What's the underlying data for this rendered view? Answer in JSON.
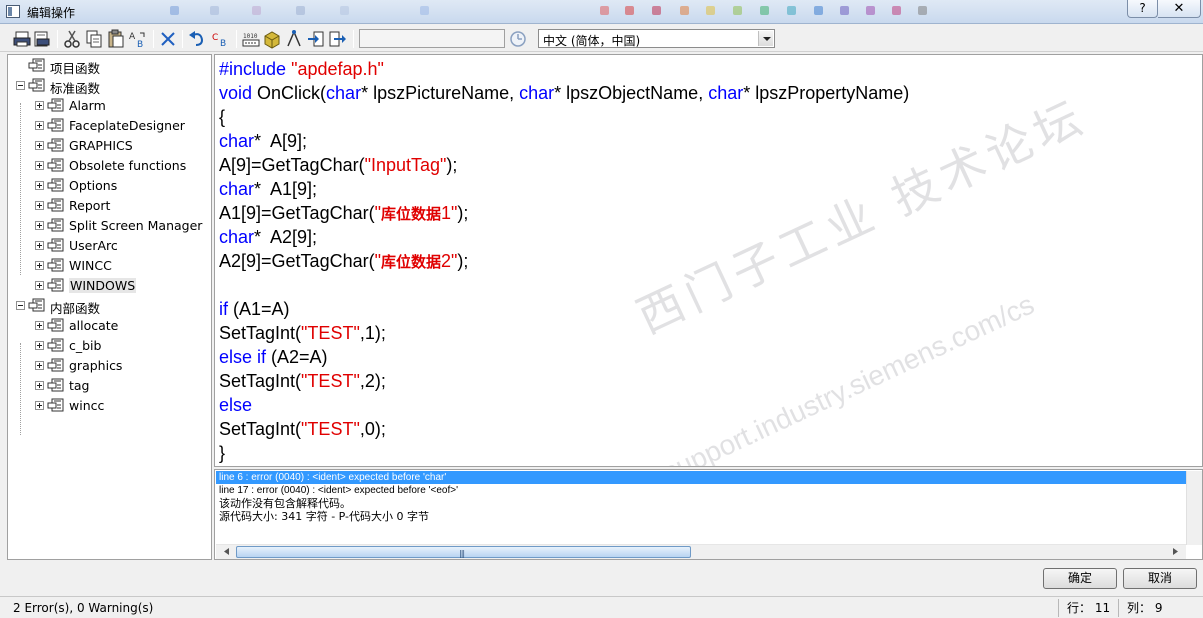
{
  "window": {
    "title": "编辑操作",
    "help_label": "?",
    "close_label": "✕"
  },
  "toolbar": {
    "icons": [
      "print-icon",
      "print-preview-icon",
      "cut-icon",
      "copy-icon",
      "paste-icon",
      "find-replace-icon",
      "delete-icon",
      "undo-icon",
      "spell-check-icon",
      "compile-icon",
      "box-icon",
      "tag-icon",
      "import-icon",
      "export-icon",
      "clock-icon"
    ],
    "blank_input_value": "",
    "language_select": "中文 (简体，中国)"
  },
  "tree": {
    "items": [
      {
        "label": "项目函数",
        "level": 0,
        "toggle": "none"
      },
      {
        "label": "标准函数",
        "level": 0,
        "toggle": "minus"
      },
      {
        "label": "Alarm",
        "level": 1,
        "toggle": "plus"
      },
      {
        "label": "FaceplateDesigner",
        "level": 1,
        "toggle": "plus"
      },
      {
        "label": "GRAPHICS",
        "level": 1,
        "toggle": "plus"
      },
      {
        "label": "Obsolete functions",
        "level": 1,
        "toggle": "plus"
      },
      {
        "label": "Options",
        "level": 1,
        "toggle": "plus"
      },
      {
        "label": "Report",
        "level": 1,
        "toggle": "plus"
      },
      {
        "label": "Split Screen Manager",
        "level": 1,
        "toggle": "plus"
      },
      {
        "label": "UserArc",
        "level": 1,
        "toggle": "plus"
      },
      {
        "label": "WINCC",
        "level": 1,
        "toggle": "plus"
      },
      {
        "label": "WINDOWS",
        "level": 1,
        "toggle": "plus",
        "selected": true
      },
      {
        "label": "内部函数",
        "level": 0,
        "toggle": "minus"
      },
      {
        "label": "allocate",
        "level": 1,
        "toggle": "plus"
      },
      {
        "label": "c_bib",
        "level": 1,
        "toggle": "plus"
      },
      {
        "label": "graphics",
        "level": 1,
        "toggle": "plus"
      },
      {
        "label": "tag",
        "level": 1,
        "toggle": "plus"
      },
      {
        "label": "wincc",
        "level": 1,
        "toggle": "plus"
      }
    ]
  },
  "code": {
    "lines": [
      [
        {
          "t": "#include ",
          "c": "kw"
        },
        {
          "t": "\"apdefap.h\"",
          "c": "str"
        }
      ],
      [
        {
          "t": "void",
          "c": "kw"
        },
        {
          "t": " OnClick("
        },
        {
          "t": "char",
          "c": "kw"
        },
        {
          "t": "* lpszPictureName, "
        },
        {
          "t": "char",
          "c": "kw"
        },
        {
          "t": "* lpszObjectName, "
        },
        {
          "t": "char",
          "c": "kw"
        },
        {
          "t": "* lpszPropertyName)"
        }
      ],
      [
        {
          "t": "{"
        }
      ],
      [
        {
          "t": "char",
          "c": "kw"
        },
        {
          "t": "*  A[9];"
        }
      ],
      [
        {
          "t": "A[9]=GetTagChar("
        },
        {
          "t": "\"InputTag\"",
          "c": "str"
        },
        {
          "t": ");"
        }
      ],
      [
        {
          "t": "char",
          "c": "kw"
        },
        {
          "t": "*  A1[9];"
        }
      ],
      [
        {
          "t": "A1[9]=GetTagChar("
        },
        {
          "t": "\"",
          "c": "str"
        },
        {
          "t": "库位数据",
          "c": "str-cn"
        },
        {
          "t": "1\"",
          "c": "str"
        },
        {
          "t": ");"
        }
      ],
      [
        {
          "t": "char",
          "c": "kw"
        },
        {
          "t": "*  A2[9];"
        }
      ],
      [
        {
          "t": "A2[9]=GetTagChar("
        },
        {
          "t": "\"",
          "c": "str"
        },
        {
          "t": "库位数据",
          "c": "str-cn"
        },
        {
          "t": "2\"",
          "c": "str"
        },
        {
          "t": ");"
        }
      ],
      [],
      [
        {
          "t": "if",
          "c": "kw"
        },
        {
          "t": " (A1=A)"
        }
      ],
      [
        {
          "t": "SetTagInt("
        },
        {
          "t": "\"TEST\"",
          "c": "str"
        },
        {
          "t": ",1);"
        }
      ],
      [
        {
          "t": "else if",
          "c": "kw"
        },
        {
          "t": " (A2=A)"
        }
      ],
      [
        {
          "t": "SetTagInt("
        },
        {
          "t": "\"TEST\"",
          "c": "str"
        },
        {
          "t": ",2);"
        }
      ],
      [
        {
          "t": "else",
          "c": "kw"
        }
      ],
      [
        {
          "t": "SetTagInt("
        },
        {
          "t": "\"TEST\"",
          "c": "str"
        },
        {
          "t": ",0);"
        }
      ],
      [
        {
          "t": "}"
        }
      ]
    ],
    "colors": {
      "keyword": "#0000ff",
      "string": "#e00000",
      "text": "#000000"
    }
  },
  "watermark": {
    "text_cn": "西门子工业 技术论坛",
    "text_url": "support.industry.siemens.com/cs"
  },
  "output": {
    "lines": [
      "line 6 : error (0040) : <ident> expected before 'char'",
      "line 17 : error (0040) : <ident> expected before '<eof>'",
      "该动作没有包含解释代码。",
      "源代码大小: 341 字符 - P-代码大小 0 字节"
    ],
    "selected_index": 0,
    "scroll_grip": "|||"
  },
  "buttons": {
    "ok": "确定",
    "cancel": "取消"
  },
  "status": {
    "message": "2 Error(s), 0 Warning(s)",
    "row": "行： 11",
    "col": "列： 9"
  }
}
